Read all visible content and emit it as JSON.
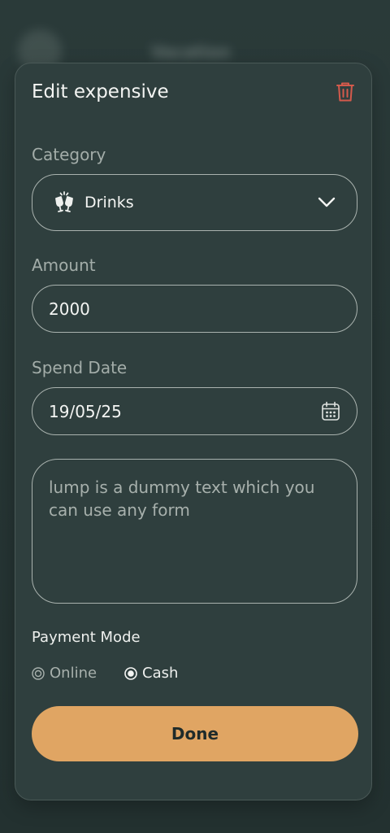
{
  "background": {
    "title": "Vacation"
  },
  "sheet": {
    "title": "Edit expensive"
  },
  "category": {
    "label": "Category",
    "value": "Drinks",
    "icon": "drinks-cheers-icon"
  },
  "amount": {
    "label": "Amount",
    "value": "2000"
  },
  "spend_date": {
    "label": "Spend Date",
    "value": "19/05/25"
  },
  "note": {
    "value": "lump is a dummy text which you can use any form"
  },
  "payment_mode": {
    "label": "Payment Mode",
    "options": [
      "Online",
      "Cash"
    ],
    "selected": "Cash"
  },
  "done_button": {
    "label": "Done"
  },
  "colors": {
    "accent": "#e0a563",
    "delete": "#d45a4c",
    "sheet_bg": "#2f3f3e"
  }
}
